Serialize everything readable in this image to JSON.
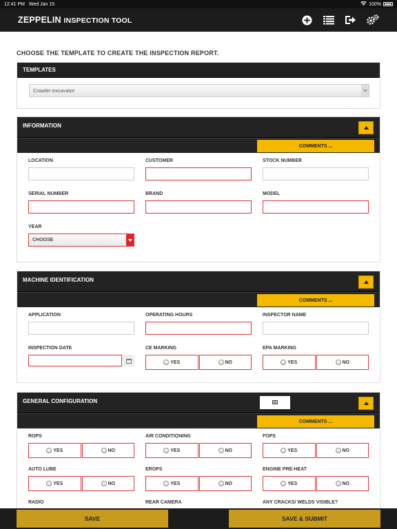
{
  "status_bar": {
    "time": "12:41 PM",
    "date": "Wed Jan 15",
    "battery": "100%"
  },
  "app": {
    "brand": "ZEPPELIN",
    "title": "INSPECTION TOOL"
  },
  "header_icons": [
    "add-circle-icon",
    "list-icon",
    "logout-icon",
    "settings-icon"
  ],
  "page": {
    "heading": "CHOOSE THE TEMPLATE TO CREATE THE INSPECTION REPORT."
  },
  "templates": {
    "title": "TEMPLATES",
    "selected": "Crawler excavator"
  },
  "information": {
    "title": "INFORMATION",
    "comments": "COMMENTS ...",
    "fields": {
      "location": "LOCATION",
      "customer": "CUSTOMER",
      "stock_number": "STOCK NUMBER",
      "serial_number": "SERIAL NUMBER",
      "brand": "BRAND",
      "model": "MODEL",
      "year": "YEAR"
    },
    "year_value": "CHOOSE"
  },
  "machine_identification": {
    "title": "MACHINE IDENTIFICATION",
    "comments": "COMMENTS ...",
    "fields": {
      "application": "APPLICATION",
      "operating_hours": "OPERATING HOURS",
      "inspector_name": "INSPECTOR NAME",
      "inspection_date": "INSPECTION DATE",
      "ce_marking": "CE MARKING",
      "epa_marking": "EPA MARKING"
    }
  },
  "general_configuration": {
    "title": "GENERAL CONFIGURATION",
    "comments": "COMMENTS ...",
    "fields": {
      "rops": "ROPS",
      "air_conditioning": "AIR CONDITIONING",
      "fops": "FOPS",
      "auto_lube": "AUTO LUBE",
      "erops": "EROPS",
      "engine_preheat": "ENGINE PRE-HEAT",
      "radio": "RADIO",
      "rear_camera": "REAR CAMERA",
      "cracks": "ANY CRACKS/ WELDS VISIBLE?"
    }
  },
  "options": {
    "yes": "YES",
    "no": "NO"
  },
  "footer": {
    "save": "SAVE",
    "save_submit": "SAVE & SUBMIT"
  },
  "colors": {
    "accent": "#f5b800",
    "required": "#d9343b",
    "header_bg": "#1c1c1c"
  }
}
